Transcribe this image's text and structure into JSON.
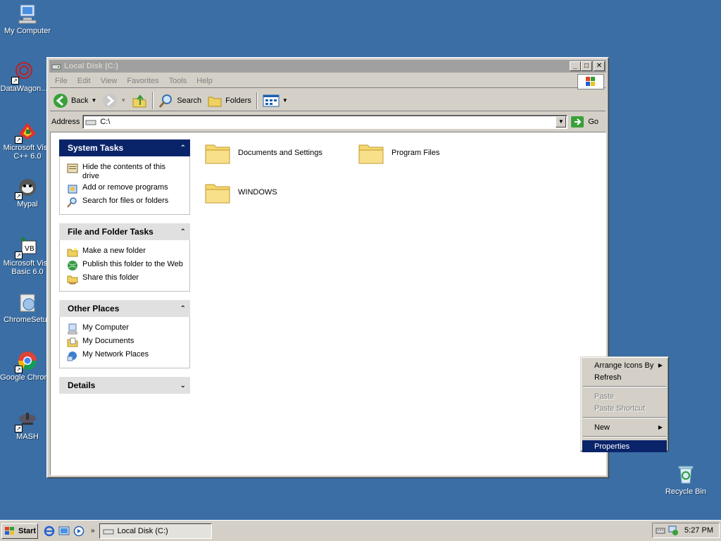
{
  "desktop": {
    "icons": [
      {
        "label": "My Computer"
      },
      {
        "label": "DataWagon..."
      },
      {
        "label": "Microsoft Visual C++ 6.0",
        "line1": "Microsoft Visu",
        "line2": "C++ 6.0"
      },
      {
        "label": "Mypal"
      },
      {
        "label": "Microsoft Visual Basic 6.0",
        "line1": "Microsoft Visu",
        "line2": "Basic 6.0"
      },
      {
        "label": "ChromeSetup"
      },
      {
        "label": "Google Chrome"
      },
      {
        "label": "MASH"
      },
      {
        "label": "Recycle Bin"
      }
    ]
  },
  "window": {
    "title": "Local Disk (C:)",
    "menu": [
      "File",
      "Edit",
      "View",
      "Favorites",
      "Tools",
      "Help"
    ],
    "toolbar": {
      "back": "Back",
      "search": "Search",
      "folders": "Folders"
    },
    "address": {
      "label": "Address",
      "value": "C:\\",
      "go": "Go"
    },
    "taskpane": {
      "system_tasks": {
        "title": "System Tasks",
        "items": [
          "Hide the contents of this drive",
          "Add or remove programs",
          "Search for files or folders"
        ]
      },
      "file_folder_tasks": {
        "title": "File and Folder Tasks",
        "items": [
          "Make a new folder",
          "Publish this folder to the Web",
          "Share this folder"
        ]
      },
      "other_places": {
        "title": "Other Places",
        "items": [
          "My Computer",
          "My Documents",
          "My Network Places"
        ]
      },
      "details": {
        "title": "Details"
      }
    },
    "folders": [
      "Documents and Settings",
      "Program Files",
      "WINDOWS"
    ]
  },
  "context_menu": {
    "items": [
      {
        "label": "Arrange Icons By",
        "submenu": true,
        "enabled": true
      },
      {
        "label": "Refresh",
        "enabled": true
      },
      {
        "label": "Paste",
        "enabled": false
      },
      {
        "label": "Paste Shortcut",
        "enabled": false
      },
      {
        "label": "New",
        "submenu": true,
        "enabled": true
      },
      {
        "label": "Properties",
        "enabled": true,
        "highlighted": true
      }
    ]
  },
  "taskbar": {
    "start": "Start",
    "task": "Local Disk (C:)",
    "clock": "5:27 PM"
  },
  "colors": {
    "desktop": "#3a6ea5",
    "highlight": "#0a246a",
    "face": "#d4d0c8"
  }
}
